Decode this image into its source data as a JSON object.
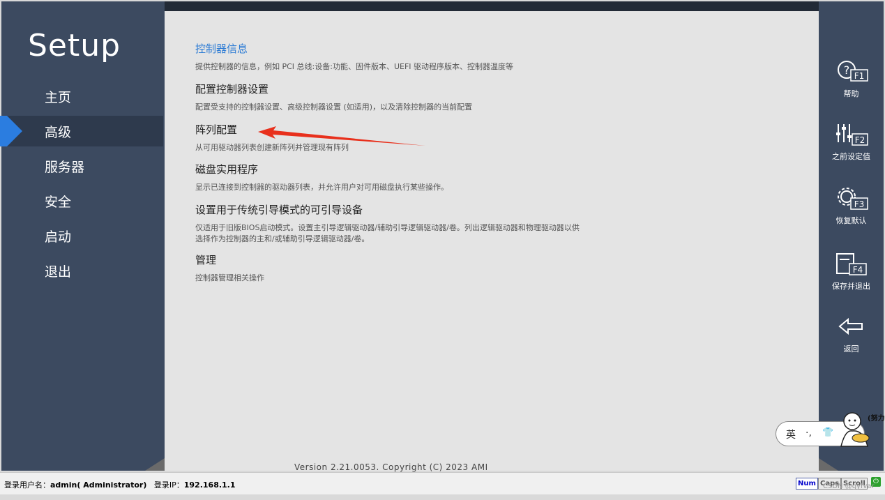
{
  "sidebar": {
    "title": "Setup",
    "items": [
      {
        "label": "主页"
      },
      {
        "label": "高级"
      },
      {
        "label": "服务器"
      },
      {
        "label": "安全"
      },
      {
        "label": "启动"
      },
      {
        "label": "退出"
      }
    ],
    "active_index": 1
  },
  "main": {
    "items": [
      {
        "title": "控制器信息",
        "desc": "提供控制器的信息，例如 PCI 总线:设备:功能、固件版本、UEFI 驱动程序版本、控制器温度等"
      },
      {
        "title": "配置控制器设置",
        "desc": "配置受支持的控制器设置、高级控制器设置 (如适用)，以及清除控制器的当前配置"
      },
      {
        "title": "阵列配置",
        "desc": "从可用驱动器列表创建新阵列并管理现有阵列"
      },
      {
        "title": "磁盘实用程序",
        "desc": "显示已连接到控制器的驱动器列表，并允许用户对可用磁盘执行某些操作。"
      },
      {
        "title": "设置用于传统引导模式的可引导设备",
        "desc": "仅适用于旧版BIOS启动模式。设置主引导逻辑驱动器/辅助引导逻辑驱动器/卷。列出逻辑驱动器和物理驱动器以供\n选择作为控制器的主和/或辅助引导逻辑驱动器/卷。"
      },
      {
        "title": "管理",
        "desc": "控制器管理相关操作"
      }
    ],
    "version": "Version 2.21.0053. Copyright (C) 2023 AMI"
  },
  "right_panel": {
    "buttons": [
      {
        "key": "F1",
        "label": "帮助",
        "icon": "help-icon"
      },
      {
        "key": "F2",
        "label": "之前设定值",
        "icon": "sliders-icon"
      },
      {
        "key": "F3",
        "label": "恢复默认",
        "icon": "gear-icon"
      },
      {
        "key": "F4",
        "label": "保存并退出",
        "icon": "save-exit-icon"
      },
      {
        "key": "",
        "label": "返回",
        "icon": "back-arrow-icon"
      }
    ]
  },
  "status_bar": {
    "user_label": "登录用户名：",
    "user_value": "admin( Administrator)",
    "ip_label": "登录IP：",
    "ip_value": "192.168.1.1",
    "keys": [
      "Num",
      "Caps",
      "Scroll"
    ],
    "watermark": "CSDN @gyfvar"
  },
  "ime": {
    "lang": "英",
    "punct": "·,",
    "mascot_text": "(努力"
  },
  "colors": {
    "sidebar_bg": "#3c4a60",
    "active_marker": "#2b7de0",
    "link": "#2a7ad4",
    "annotation_arrow": "#e8301c"
  }
}
